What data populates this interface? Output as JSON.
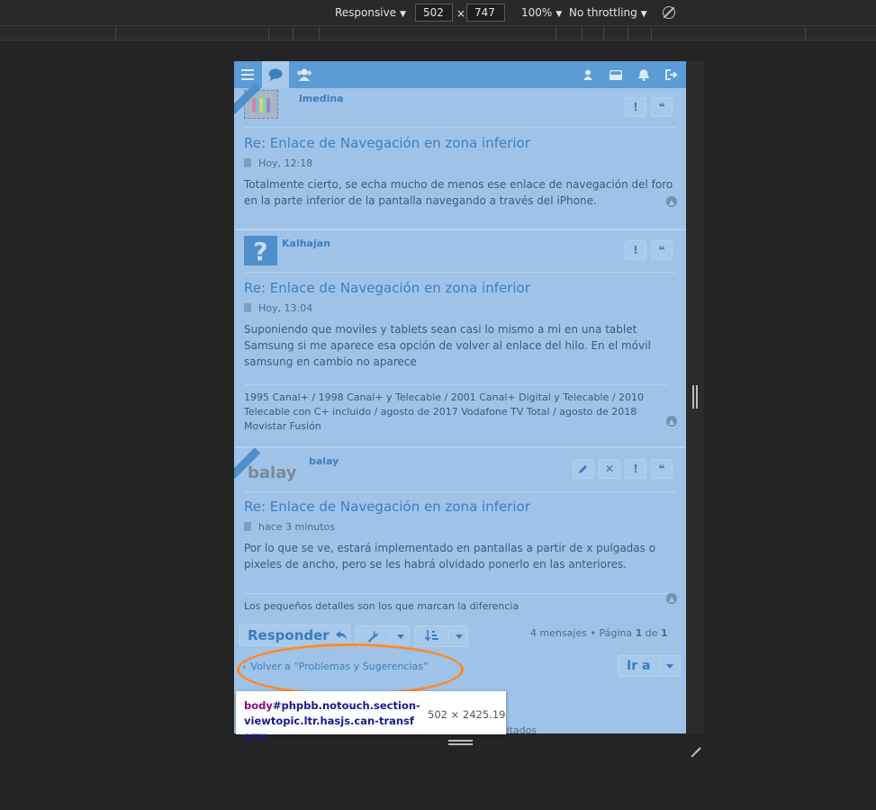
{
  "toolbar": {
    "device_mode": "Responsive",
    "width": "502",
    "times": "×",
    "height": "747",
    "zoom": "100%",
    "throttling": "No throttling"
  },
  "forum": {
    "posts": [
      {
        "author": "lmedina",
        "title": "Re: Enlace de Navegación en zona inferior",
        "time": "Hoy, 12:18",
        "body": "Totalmente cierto, se echa mucho de menos ese enlace de navegación del foro en la parte inferior de la pantalla navegando a través del iPhone."
      },
      {
        "author": "Kalhajan",
        "title": "Re: Enlace de Navegación en zona inferior",
        "time": "Hoy, 13:04",
        "body": "Suponiendo que moviles y tablets sean casi lo mismo a mi en una tablet Samsung si me aparece esa opción de volver al enlace del hilo. En el móvil samsung en cambio no aparece",
        "signature": "1995 Canal+ / 1998 Canal+ y Telecable / 2001 Canal+ Digital y Telecable / 2010 Telecable con C+ incluido / agosto de 2017 Vodafone TV Total / agosto de 2018 Movistar Fusión"
      },
      {
        "author": "balay",
        "avatar_text": "balay",
        "title": "Re: Enlace de Navegación en zona inferior",
        "time": "hace 3 minutos",
        "body": "Por lo que se ve, estará implementado en pantallas a partir de x pulgadas o pixeles de ancho, pero se les habrá olvidado ponerlo en las anteriores.",
        "signature": "Los pequeños detalles son los que marcan la diferencia"
      }
    ],
    "actions": {
      "reply": "Responder",
      "pagination_prefix": "4 mensajes • Página ",
      "page_current": "1",
      "page_of": " de ",
      "page_total": "1",
      "back": "Volver a “Problemas y Sugerencias”",
      "goto": "Ir a"
    },
    "hidden_fragment": "vitados"
  },
  "inspector_tooltip": {
    "tag": "body",
    "selector": "#phpbb.notouch.section-viewtopic.ltr.hasjs.can-transform",
    "size": "502 × 2425.19"
  },
  "colors": {
    "page_overlay": "#9fc3e8",
    "navbar": "#5b9bd6",
    "link": "#3d7fbf",
    "highlight": "#ff8a2b",
    "devtools_bg": "#242424"
  }
}
